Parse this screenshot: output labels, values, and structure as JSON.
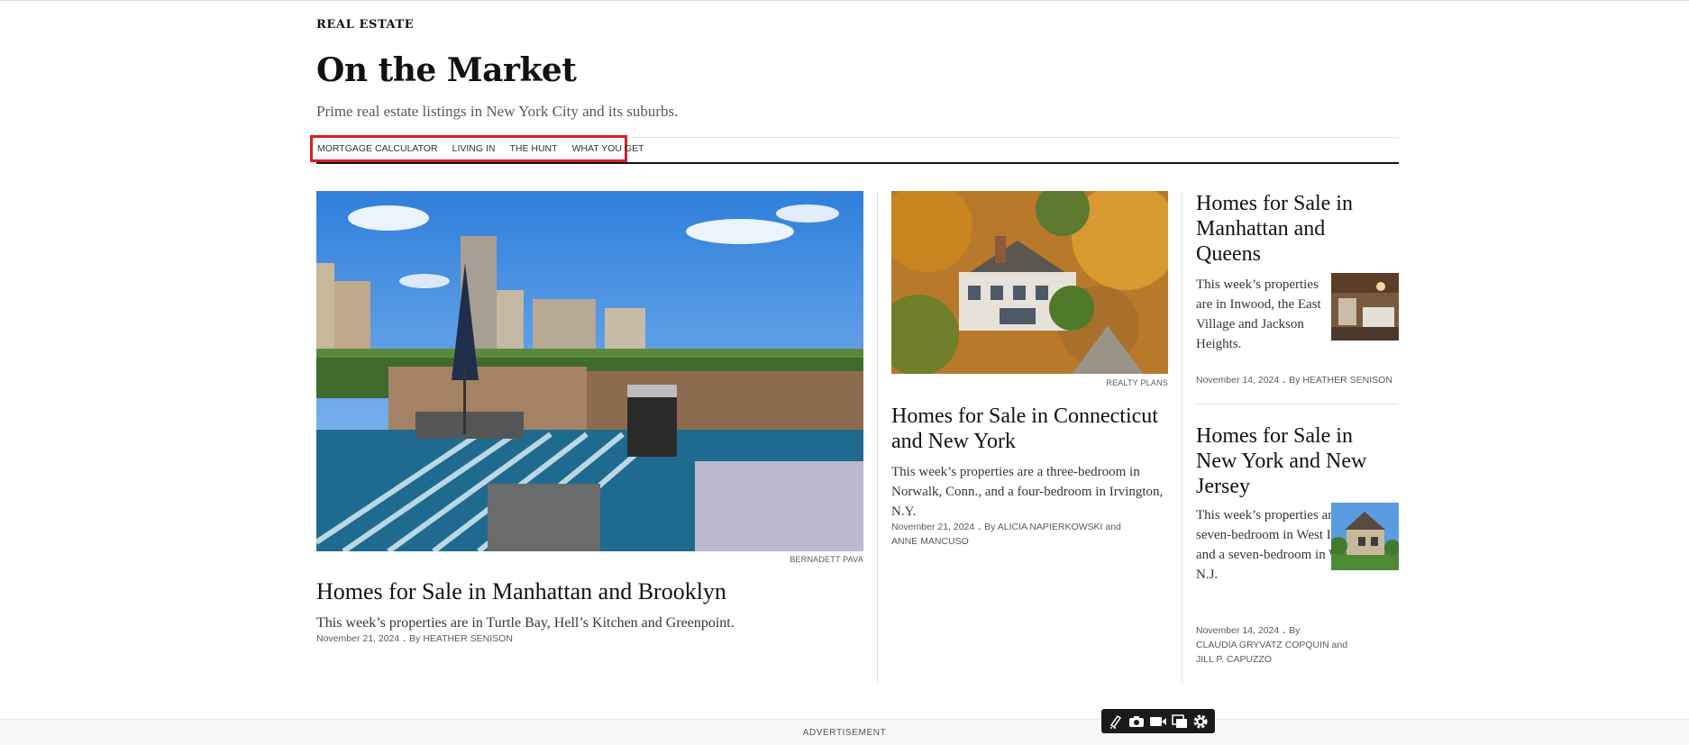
{
  "section": {
    "kicker": "REAL ESTATE",
    "title": "On the Market",
    "subtitle": "Prime real estate listings in New York City and its suburbs."
  },
  "subnav": {
    "items": [
      {
        "label": "MORTGAGE CALCULATOR"
      },
      {
        "label": "LIVING IN"
      },
      {
        "label": "THE HUNT"
      },
      {
        "label": "WHAT YOU GET"
      }
    ],
    "highlight_color": "#d6202c"
  },
  "articles": {
    "lead": {
      "credit": "BERNADETT PAVA",
      "headline": "Homes for Sale in Manhattan and Brooklyn",
      "summary": "This week’s properties are in Turtle Bay, Hell’s Kitchen and Greenpoint.",
      "date": "November 21, 2024",
      "byline": "By HEATHER SENISON"
    },
    "middle": {
      "credit": "REALTY PLANS",
      "headline": "Homes for Sale in Connecticut and New York",
      "summary": "This week’s properties are a three-bedroom in Norwalk, Conn., and a four-bedroom in Irvington, N.Y.",
      "date": "November 21, 2024",
      "byline_line1": "By ALICIA NAPIERKOWSKI and",
      "byline_line2": "ANNE MANCUSO"
    },
    "right_top": {
      "headline": "Homes for Sale in Manhattan and Queens",
      "summary": "This week’s properties are in Inwood, the East Village and Jackson Heights.",
      "date": "November 14, 2024",
      "byline": "By HEATHER SENISON"
    },
    "right_bottom": {
      "headline": "Homes for Sale in New York and New Jersey",
      "summary": "This week’s properties are a seven-bedroom in West Islip, N.Y., and a seven-bedroom in Westfield, N.J.",
      "date": "November 14, 2024",
      "byline_prefix": "By",
      "byline_line2": "CLAUDIA GRYVATZ COPQUIN and",
      "byline_line3": "JILL P. CAPUZZO"
    }
  },
  "footer": {
    "ad_label": "ADVERTISEMENT"
  },
  "toolbar": {
    "icons": [
      "edit-cursor-icon",
      "camera-icon",
      "video-icon",
      "copy-icon",
      "gear-icon"
    ]
  }
}
